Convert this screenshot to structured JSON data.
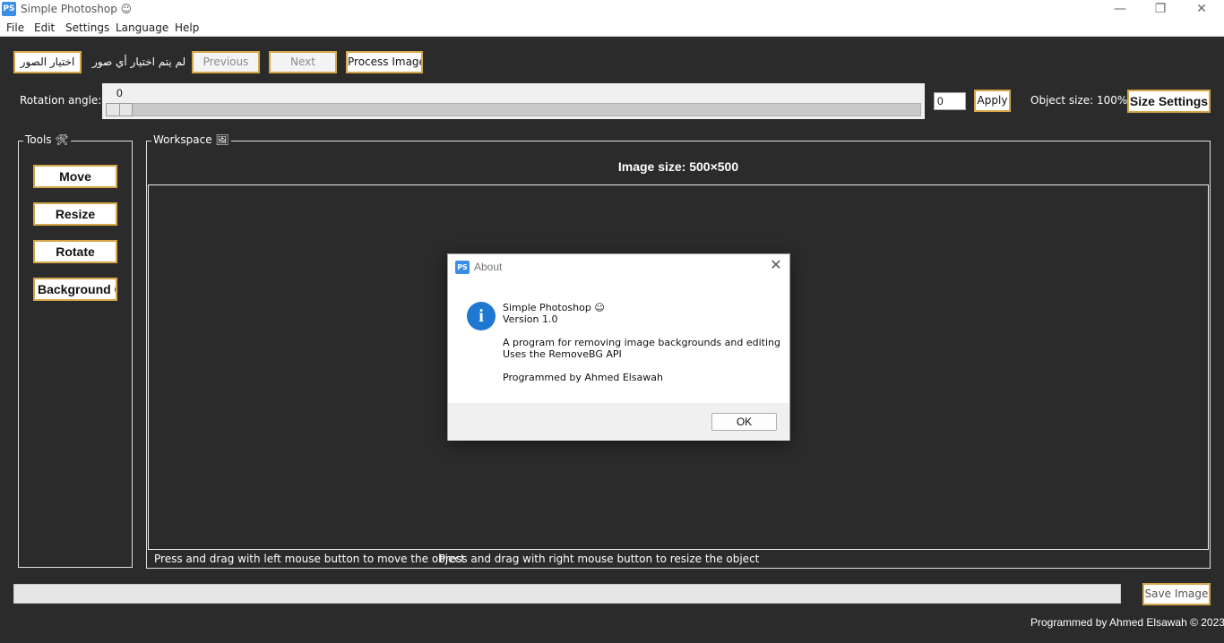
{
  "window": {
    "title": "Simple Photoshop ☺",
    "icon_text": "PS",
    "minimize": "—",
    "restore": "❐",
    "close": "✕"
  },
  "menu": [
    "File",
    "Edit",
    "Settings",
    "Language",
    "Help"
  ],
  "toolbar": {
    "choose_images": "اختيار الصور",
    "no_images_status": "لم يتم اختيار أي صور",
    "previous": "Previous",
    "next": "Next",
    "process_image": "Process Image"
  },
  "rotation": {
    "label": "Rotation angle:",
    "slider_value": "0",
    "slider_fraction": 0,
    "input_value": "0",
    "apply": "Apply",
    "object_size": "Object size: 100%",
    "size_settings": "Size Settings"
  },
  "tools": {
    "title": "Tools 🛠",
    "buttons": [
      "Move",
      "Resize",
      "Rotate",
      "Background C"
    ]
  },
  "workspace": {
    "title": "Workspace 🖼",
    "image_size": "Image size: 500×500",
    "hint_left": "Press and drag with left mouse button to move the object",
    "hint_right": "Press and drag with right mouse button to resize the object"
  },
  "footer": {
    "save_image": "Save Image",
    "credit": "Programmed by Ahmed Elsawah © 2023",
    "progress_fraction": 0
  },
  "about_dialog": {
    "title": "About",
    "app_name": "Simple Photoshop ☺",
    "version": "Version 1.0",
    "description": "A program for removing image backgrounds and editing",
    "api": "Uses the RemoveBG API",
    "author": "Programmed by Ahmed Elsawah",
    "ok": "OK",
    "close": "✕",
    "info_glyph": "i"
  },
  "colors": {
    "background": "#2b2b2b",
    "button_border": "#d4a84a",
    "info_icon": "#1f78d1"
  }
}
